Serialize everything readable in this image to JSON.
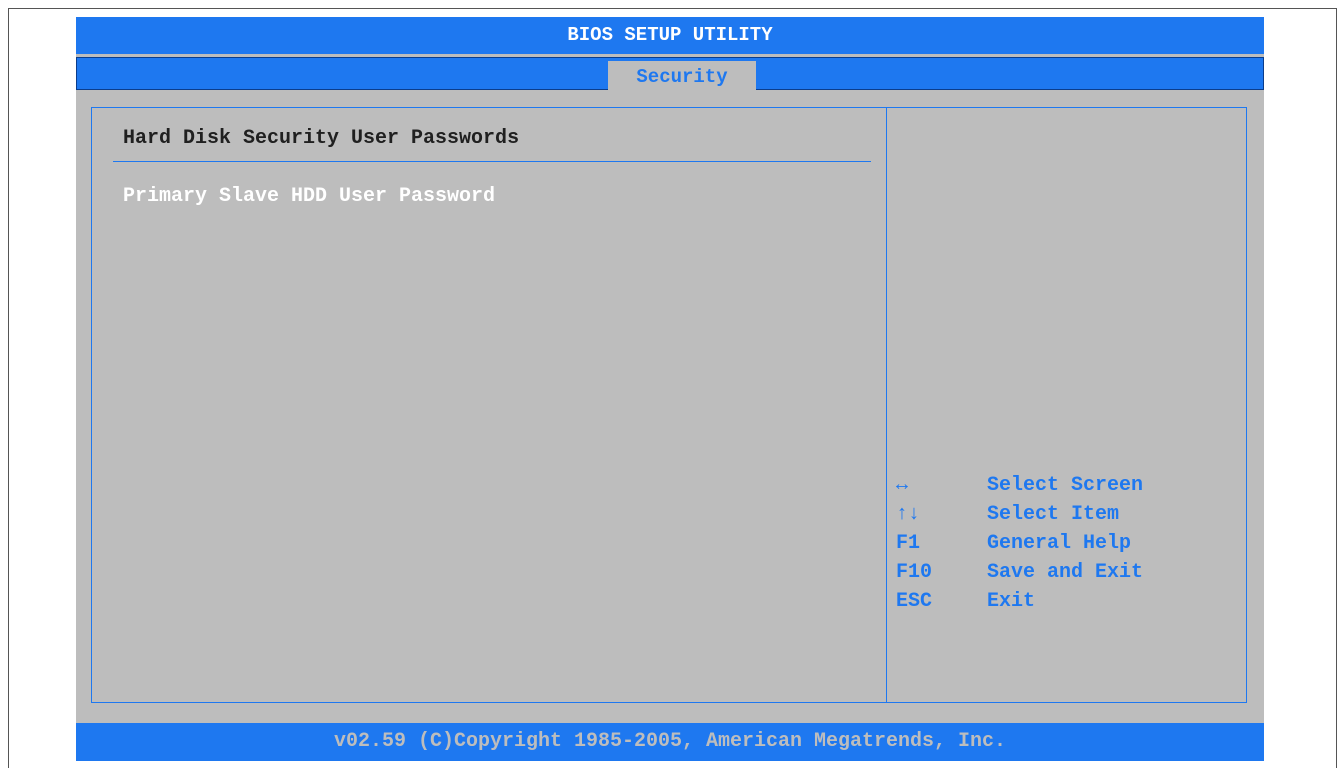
{
  "header": {
    "title": "BIOS SETUP UTILITY"
  },
  "tabs": [
    {
      "label": "Security",
      "active": true
    }
  ],
  "main": {
    "section_title": "Hard Disk Security User Passwords",
    "items": [
      {
        "label": "Primary Slave HDD User Password"
      }
    ]
  },
  "help": {
    "keys": [
      {
        "key": "↔",
        "desc": "Select Screen"
      },
      {
        "key": "↑↓",
        "desc": "Select Item"
      },
      {
        "key": "F1",
        "desc": "General Help"
      },
      {
        "key": "F10",
        "desc": "Save and Exit"
      },
      {
        "key": "ESC",
        "desc": "Exit"
      }
    ]
  },
  "footer": {
    "text": "v02.59 (C)Copyright 1985-2005, American Megatrends, Inc."
  },
  "colors": {
    "accent": "#1e78f0",
    "panel": "#bdbdbd",
    "text_dark": "#202020",
    "text_light": "#ffffff"
  }
}
